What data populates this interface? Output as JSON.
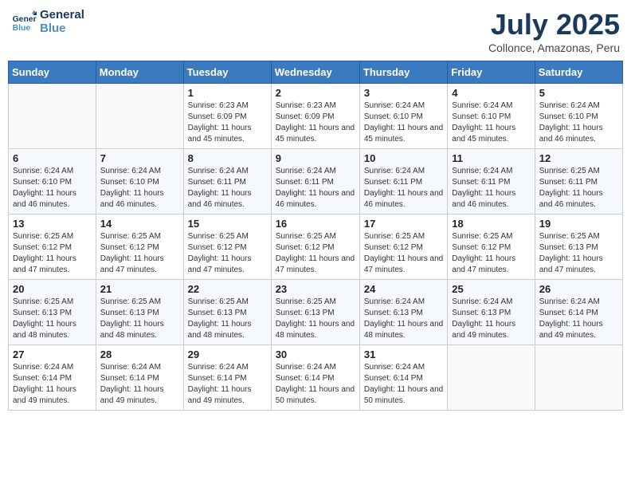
{
  "logo": {
    "line1": "General",
    "line2": "Blue"
  },
  "title": "July 2025",
  "subtitle": "Collonce, Amazonas, Peru",
  "days_of_week": [
    "Sunday",
    "Monday",
    "Tuesday",
    "Wednesday",
    "Thursday",
    "Friday",
    "Saturday"
  ],
  "weeks": [
    [
      {
        "day": "",
        "info": ""
      },
      {
        "day": "",
        "info": ""
      },
      {
        "day": "1",
        "info": "Sunrise: 6:23 AM\nSunset: 6:09 PM\nDaylight: 11 hours and 45 minutes."
      },
      {
        "day": "2",
        "info": "Sunrise: 6:23 AM\nSunset: 6:09 PM\nDaylight: 11 hours and 45 minutes."
      },
      {
        "day": "3",
        "info": "Sunrise: 6:24 AM\nSunset: 6:10 PM\nDaylight: 11 hours and 45 minutes."
      },
      {
        "day": "4",
        "info": "Sunrise: 6:24 AM\nSunset: 6:10 PM\nDaylight: 11 hours and 45 minutes."
      },
      {
        "day": "5",
        "info": "Sunrise: 6:24 AM\nSunset: 6:10 PM\nDaylight: 11 hours and 46 minutes."
      }
    ],
    [
      {
        "day": "6",
        "info": "Sunrise: 6:24 AM\nSunset: 6:10 PM\nDaylight: 11 hours and 46 minutes."
      },
      {
        "day": "7",
        "info": "Sunrise: 6:24 AM\nSunset: 6:10 PM\nDaylight: 11 hours and 46 minutes."
      },
      {
        "day": "8",
        "info": "Sunrise: 6:24 AM\nSunset: 6:11 PM\nDaylight: 11 hours and 46 minutes."
      },
      {
        "day": "9",
        "info": "Sunrise: 6:24 AM\nSunset: 6:11 PM\nDaylight: 11 hours and 46 minutes."
      },
      {
        "day": "10",
        "info": "Sunrise: 6:24 AM\nSunset: 6:11 PM\nDaylight: 11 hours and 46 minutes."
      },
      {
        "day": "11",
        "info": "Sunrise: 6:24 AM\nSunset: 6:11 PM\nDaylight: 11 hours and 46 minutes."
      },
      {
        "day": "12",
        "info": "Sunrise: 6:25 AM\nSunset: 6:11 PM\nDaylight: 11 hours and 46 minutes."
      }
    ],
    [
      {
        "day": "13",
        "info": "Sunrise: 6:25 AM\nSunset: 6:12 PM\nDaylight: 11 hours and 47 minutes."
      },
      {
        "day": "14",
        "info": "Sunrise: 6:25 AM\nSunset: 6:12 PM\nDaylight: 11 hours and 47 minutes."
      },
      {
        "day": "15",
        "info": "Sunrise: 6:25 AM\nSunset: 6:12 PM\nDaylight: 11 hours and 47 minutes."
      },
      {
        "day": "16",
        "info": "Sunrise: 6:25 AM\nSunset: 6:12 PM\nDaylight: 11 hours and 47 minutes."
      },
      {
        "day": "17",
        "info": "Sunrise: 6:25 AM\nSunset: 6:12 PM\nDaylight: 11 hours and 47 minutes."
      },
      {
        "day": "18",
        "info": "Sunrise: 6:25 AM\nSunset: 6:12 PM\nDaylight: 11 hours and 47 minutes."
      },
      {
        "day": "19",
        "info": "Sunrise: 6:25 AM\nSunset: 6:13 PM\nDaylight: 11 hours and 47 minutes."
      }
    ],
    [
      {
        "day": "20",
        "info": "Sunrise: 6:25 AM\nSunset: 6:13 PM\nDaylight: 11 hours and 48 minutes."
      },
      {
        "day": "21",
        "info": "Sunrise: 6:25 AM\nSunset: 6:13 PM\nDaylight: 11 hours and 48 minutes."
      },
      {
        "day": "22",
        "info": "Sunrise: 6:25 AM\nSunset: 6:13 PM\nDaylight: 11 hours and 48 minutes."
      },
      {
        "day": "23",
        "info": "Sunrise: 6:25 AM\nSunset: 6:13 PM\nDaylight: 11 hours and 48 minutes."
      },
      {
        "day": "24",
        "info": "Sunrise: 6:24 AM\nSunset: 6:13 PM\nDaylight: 11 hours and 48 minutes."
      },
      {
        "day": "25",
        "info": "Sunrise: 6:24 AM\nSunset: 6:13 PM\nDaylight: 11 hours and 49 minutes."
      },
      {
        "day": "26",
        "info": "Sunrise: 6:24 AM\nSunset: 6:14 PM\nDaylight: 11 hours and 49 minutes."
      }
    ],
    [
      {
        "day": "27",
        "info": "Sunrise: 6:24 AM\nSunset: 6:14 PM\nDaylight: 11 hours and 49 minutes."
      },
      {
        "day": "28",
        "info": "Sunrise: 6:24 AM\nSunset: 6:14 PM\nDaylight: 11 hours and 49 minutes."
      },
      {
        "day": "29",
        "info": "Sunrise: 6:24 AM\nSunset: 6:14 PM\nDaylight: 11 hours and 49 minutes."
      },
      {
        "day": "30",
        "info": "Sunrise: 6:24 AM\nSunset: 6:14 PM\nDaylight: 11 hours and 50 minutes."
      },
      {
        "day": "31",
        "info": "Sunrise: 6:24 AM\nSunset: 6:14 PM\nDaylight: 11 hours and 50 minutes."
      },
      {
        "day": "",
        "info": ""
      },
      {
        "day": "",
        "info": ""
      }
    ]
  ]
}
